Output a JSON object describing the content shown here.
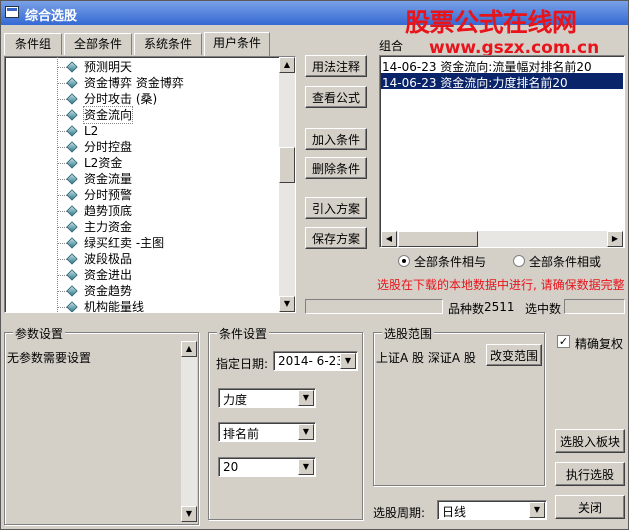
{
  "window": {
    "title": "综合选股"
  },
  "watermark": {
    "line1": "股票公式在线网",
    "line2": "www.gszx.com.cn"
  },
  "tabs": [
    "条件组",
    "全部条件",
    "系统条件",
    "用户条件"
  ],
  "tree": {
    "items": [
      "预测明天",
      "资金博弈 资金博弈",
      "分时攻击 (桑)",
      "资金流向",
      "L2",
      "分时控盘",
      "L2资金",
      "资金流量",
      "分时预警",
      "趋势顶底",
      "主力资金",
      "绿买红卖 -主图",
      "波段极品",
      "资金进出",
      "资金趋势",
      "机构能量线"
    ],
    "selected_index": 3
  },
  "side_buttons": {
    "usage": "用法注释",
    "view_formula": "查看公式",
    "add": "加入条件",
    "delete": "删除条件",
    "import": "引入方案",
    "save": "保存方案"
  },
  "combo": {
    "label": "组合",
    "items": [
      "14-06-23 资金流向:流量幅对排名前20",
      "14-06-23 资金流向:力度排名前20"
    ],
    "selected_index": 1
  },
  "logic": {
    "and_label": "全部条件相与",
    "or_label": "全部条件相或",
    "selected": "and"
  },
  "notice": "选股在下载的本地数据中进行, 请确保数据完整",
  "status": {
    "count_label": "品种数",
    "count": "2511",
    "selected_label": "选中数",
    "selected_value": ""
  },
  "params": {
    "title": "参数设置",
    "text": "无参数需要设置"
  },
  "cond": {
    "title": "条件设置",
    "date_label": "指定日期:",
    "date": "2014- 6-23",
    "dd1": "力度",
    "dd2": "排名前",
    "dd3": "20"
  },
  "range": {
    "title": "选股范围",
    "text": "上证A 股 深证A 股",
    "change_button": "改变范围"
  },
  "options": {
    "fq_label": "精确复权",
    "fq_checked": true
  },
  "actions": {
    "to_block": "选股入板块",
    "execute": "执行选股",
    "close": "关闭"
  },
  "period": {
    "label": "选股周期:",
    "value": "日线"
  },
  "colors": {
    "title_bg": "#3569d4",
    "selection": "#0a246a",
    "notice": "#e8141b",
    "watermark": "#e8141b"
  }
}
